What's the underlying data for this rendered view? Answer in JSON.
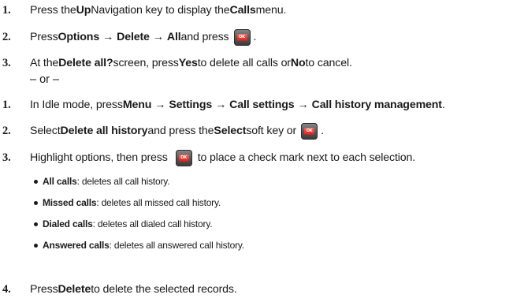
{
  "steps_a": [
    {
      "num": "1.",
      "segments": [
        "Press the ",
        "Up",
        " Navigation key to display the ",
        "Calls",
        " menu."
      ]
    },
    {
      "num": "2.",
      "segments": [
        "Press ",
        "Options",
        "Delete",
        "All",
        " and press"
      ],
      "arrow": "→"
    },
    {
      "num": "3.",
      "segments": [
        "At the ",
        "Delete all?",
        " screen, press ",
        "Yes",
        " to delete all calls or ",
        "No",
        " to cancel."
      ]
    }
  ],
  "or_text": "– or –",
  "steps_b": [
    {
      "num": "1.",
      "segments": [
        "In Idle mode, press ",
        "Menu",
        "Settings",
        "Call settings",
        "Call history management",
        "."
      ],
      "arrow": "→"
    },
    {
      "num": "2.",
      "segments": [
        "Select ",
        "Delete all history",
        " and press the ",
        "Select",
        " soft key or"
      ]
    },
    {
      "num": "3.",
      "segments": [
        "Highlight options, then press",
        "to place a check mark next to each selection."
      ]
    }
  ],
  "bullets": [
    {
      "label": "All calls",
      "text": ": deletes all call history."
    },
    {
      "label": "Missed calls",
      "text": ": deletes all missed call history."
    },
    {
      "label": "Dialed calls",
      "text": ": deletes all dialed call history."
    },
    {
      "label": "Answered calls",
      "text": ": deletes all answered call history."
    }
  ],
  "step_final": {
    "num": "4.",
    "segments": [
      "Press ",
      "Delete",
      " to delete the selected records."
    ]
  },
  "punct": {
    "period": "."
  },
  "icons": {
    "ok_key": "ok-key-icon",
    "bullet": "bullet-dot-icon"
  },
  "colors": {
    "text": "#1a1a1a",
    "ok_key_body": "#555555",
    "ok_key_center": "#d0201a"
  }
}
